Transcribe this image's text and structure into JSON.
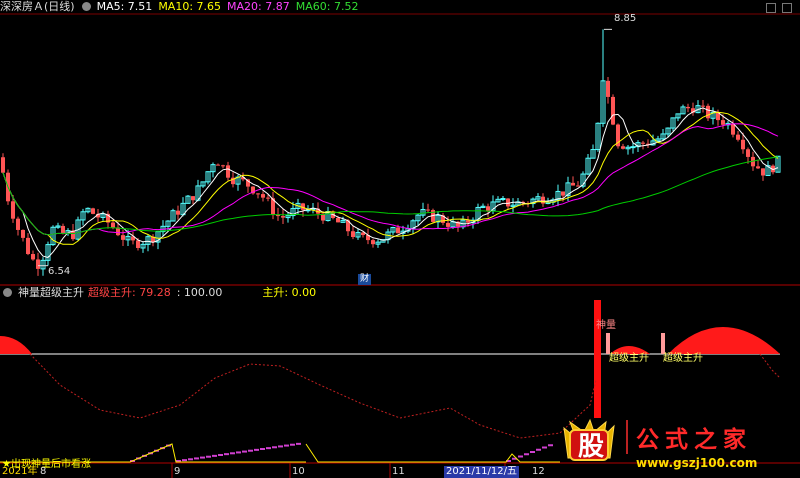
{
  "header": {
    "title": "深深房Ａ(日线)",
    "ma5_label": "MA5: 7.51",
    "ma10_label": "MA10: 7.65",
    "ma20_label": "MA20: 7.87",
    "ma60_label": "MA60: 7.52"
  },
  "indicator": {
    "name": "神量超级主升",
    "chaoji_label": "超级主升: 79.28",
    "level_label": ": 100.00",
    "zhusheng_label": "主升: 0.00"
  },
  "colors": {
    "up": "#54FFFF",
    "down": "#FF5555",
    "ma5": "#FFFFFF",
    "ma10": "#FFFF00",
    "ma20": "#FF00FF",
    "ma60": "#00CC00",
    "indicator_fill": "#FF1A1A",
    "baseline": "#FFFFFF"
  },
  "chart_data": {
    "type": "candlestick",
    "annotations": {
      "high": "8.85",
      "low": "6.54",
      "event_marker": "财",
      "shenliang_tag": "神量",
      "chaoji_tag1": "超级主升",
      "chaoji_tag2": "超级主升",
      "bottom_text": "★出现神量后市看涨"
    },
    "x_labels": [
      "2021年",
      "8",
      "9",
      "10",
      "11",
      "2021/11/12/五",
      "12"
    ],
    "price_range": [
      6.4,
      9.0
    ],
    "moving_averages": [
      {
        "name": "MA5",
        "value": 7.51
      },
      {
        "name": "MA10",
        "value": 7.65
      },
      {
        "name": "MA20",
        "value": 7.87
      },
      {
        "name": "MA60",
        "value": 7.52
      }
    ]
  },
  "watermark": {
    "glyph": "股",
    "text": "公式之家",
    "url": "www.gszj100.com"
  }
}
